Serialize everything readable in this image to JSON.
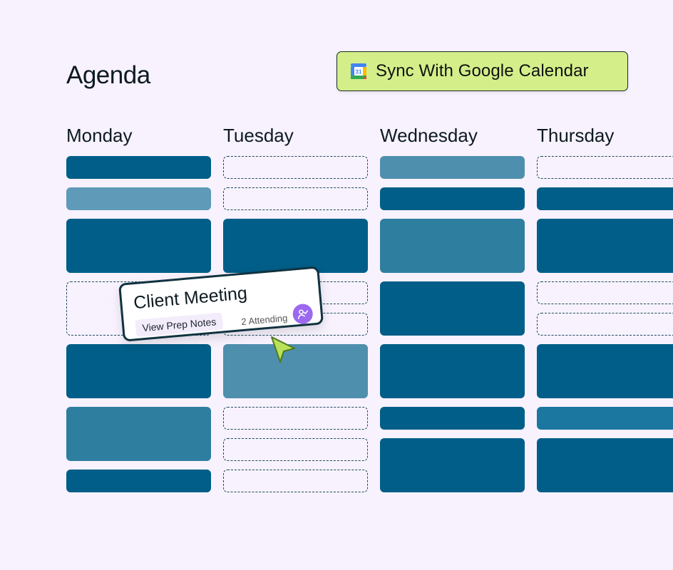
{
  "page": {
    "title": "Agenda"
  },
  "sync_button": {
    "label": "Sync With Google Calendar",
    "icon": "google-calendar-icon",
    "color": "#d4ef8a"
  },
  "days": [
    "Monday",
    "Tuesday",
    "Wednesday",
    "Thursday"
  ],
  "event_card": {
    "title": "Client Meeting",
    "action_label": "View Prep Notes",
    "attending_text": "2 Attending",
    "icon": "user-check-icon"
  },
  "colors": {
    "background": "#f7f2fd",
    "event_dark": "#005e88",
    "event_light": "#4f8fae",
    "avatar": "#9b68f0"
  }
}
